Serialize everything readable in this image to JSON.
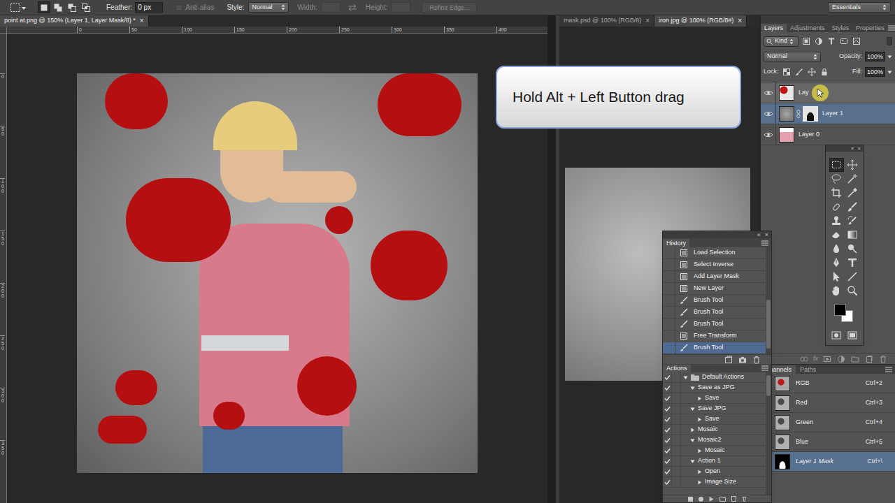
{
  "options_bar": {
    "modes": [
      {
        "selected": true
      },
      {
        "selected": false
      },
      {
        "selected": false
      },
      {
        "selected": false
      }
    ],
    "feather": {
      "label": "Feather:",
      "value": "0 px"
    },
    "anti_alias": {
      "label": "Anti-alias",
      "checked": false,
      "disabled": true
    },
    "style": {
      "label": "Style:",
      "value": "Normal"
    },
    "width": {
      "label": "Width:",
      "disabled": true
    },
    "height": {
      "label": "Height:",
      "disabled": true
    },
    "refine_edge": {
      "label": "Refine Edge...",
      "disabled": true
    },
    "workspace": "Essentials"
  },
  "main_window": {
    "tabs": [
      {
        "title": "point at.png @ 150% (Layer 1, Layer Mask/8) *",
        "close": "×",
        "selected": true
      }
    ],
    "ruler_top": [
      "0",
      "50",
      "100",
      "150",
      "200",
      "250",
      "300",
      "350",
      "400"
    ],
    "ruler_left": [
      "0",
      "50",
      "100",
      "150",
      "200",
      "250",
      "300",
      "350"
    ]
  },
  "second_window": {
    "tabs": [
      {
        "title": "mask.psd @ 100% (RGB/8)",
        "close": "×",
        "selected": false
      },
      {
        "title": "iron.jpg @ 100% (RGB/8#)",
        "close": "×",
        "selected": true
      }
    ]
  },
  "tooltip": {
    "text": "Hold Alt + Left Button drag"
  },
  "layers_panel": {
    "tabs": [
      {
        "label": "Layers",
        "selected": true
      },
      {
        "label": "Adjustments",
        "selected": false
      },
      {
        "label": "Styles",
        "selected": false
      },
      {
        "label": "Properties",
        "selected": false
      }
    ],
    "filter": "Kind",
    "blend_mode": "Normal",
    "opacity": {
      "label": "Opacity:",
      "value": "100%"
    },
    "lock_label": "Lock:",
    "fill": {
      "label": "Fill:",
      "value": "100%"
    },
    "layers": [
      {
        "name": "Lay",
        "visible": true,
        "selected": false,
        "dragging": true,
        "has_mask": false
      },
      {
        "name": "Layer 1",
        "visible": true,
        "selected": true,
        "dragging": false,
        "has_mask": true
      },
      {
        "name": "Layer 0",
        "visible": true,
        "selected": false,
        "dragging": false,
        "has_mask": false
      }
    ],
    "effects_button": "fx"
  },
  "tools": {
    "controls": {
      "collapse": "«",
      "close": "×"
    },
    "items": [
      {
        "selected": true
      },
      {
        "selected": false
      },
      {
        "selected": false
      },
      {
        "selected": false
      },
      {
        "selected": false
      },
      {
        "selected": false
      },
      {
        "selected": false
      },
      {
        "selected": false
      },
      {
        "selected": false
      },
      {
        "selected": false
      },
      {
        "selected": false
      },
      {
        "selected": false
      },
      {
        "selected": false
      },
      {
        "selected": false
      },
      {
        "selected": false
      },
      {
        "selected": false
      },
      {
        "selected": false
      },
      {
        "selected": false
      },
      {
        "selected": false
      },
      {
        "selected": false
      },
      {
        "selected": false
      },
      {
        "selected": false
      }
    ],
    "foreground": "#000000",
    "background": "#ffffff"
  },
  "history": {
    "title": "History",
    "controls": {
      "collapse": "«",
      "close": "×"
    },
    "items": [
      {
        "label": "Load Selection",
        "kind": "doc",
        "selected": false
      },
      {
        "label": "Select Inverse",
        "kind": "doc",
        "selected": false
      },
      {
        "label": "Add Layer Mask",
        "kind": "doc",
        "selected": false
      },
      {
        "label": "New Layer",
        "kind": "doc",
        "selected": false
      },
      {
        "label": "Brush Tool",
        "kind": "brush",
        "selected": false
      },
      {
        "label": "Brush Tool",
        "kind": "brush",
        "selected": false
      },
      {
        "label": "Brush Tool",
        "kind": "brush",
        "selected": false
      },
      {
        "label": "Free Transform",
        "kind": "doc",
        "selected": false
      },
      {
        "label": "Brush Tool",
        "kind": "brush",
        "selected": true
      }
    ]
  },
  "actions": {
    "title": "Actions",
    "items": [
      {
        "label": "Default Actions",
        "depth": 0,
        "kind": "folder",
        "expanded": true,
        "checked": true
      },
      {
        "label": "Save as JPG",
        "depth": 1,
        "kind": "action",
        "expanded": true,
        "checked": true
      },
      {
        "label": "Save",
        "depth": 2,
        "kind": "step",
        "expanded": false,
        "checked": true
      },
      {
        "label": "Save JPG",
        "depth": 1,
        "kind": "action",
        "expanded": true,
        "checked": true
      },
      {
        "label": "Save",
        "depth": 2,
        "kind": "step",
        "expanded": false,
        "checked": true
      },
      {
        "label": "Mosaic",
        "depth": 1,
        "kind": "action",
        "expanded": false,
        "checked": true
      },
      {
        "label": "Mosaic2",
        "depth": 1,
        "kind": "action",
        "expanded": true,
        "checked": true
      },
      {
        "label": "Mosaic",
        "depth": 2,
        "kind": "step",
        "expanded": false,
        "checked": true
      },
      {
        "label": "Action 1",
        "depth": 1,
        "kind": "action",
        "expanded": true,
        "checked": true
      },
      {
        "label": "Open",
        "depth": 2,
        "kind": "step",
        "expanded": false,
        "checked": true
      },
      {
        "label": "Image Size",
        "depth": 2,
        "kind": "step",
        "expanded": false,
        "checked": true
      }
    ]
  },
  "channels_panel": {
    "tabs": [
      {
        "label": "Channels",
        "selected": true
      },
      {
        "label": "Paths",
        "selected": false
      }
    ],
    "rows": [
      {
        "name": "RGB",
        "shortcut": "Ctrl+2",
        "kind": "composite",
        "selected": false
      },
      {
        "name": "Red",
        "shortcut": "Ctrl+3",
        "kind": "channel",
        "selected": false
      },
      {
        "name": "Green",
        "shortcut": "Ctrl+4",
        "kind": "channel",
        "selected": false
      },
      {
        "name": "Blue",
        "shortcut": "Ctrl+5",
        "kind": "channel",
        "selected": false
      },
      {
        "name": "Layer 1 Mask",
        "shortcut": "Ctrl+\\",
        "kind": "mask",
        "selected": true
      }
    ]
  }
}
